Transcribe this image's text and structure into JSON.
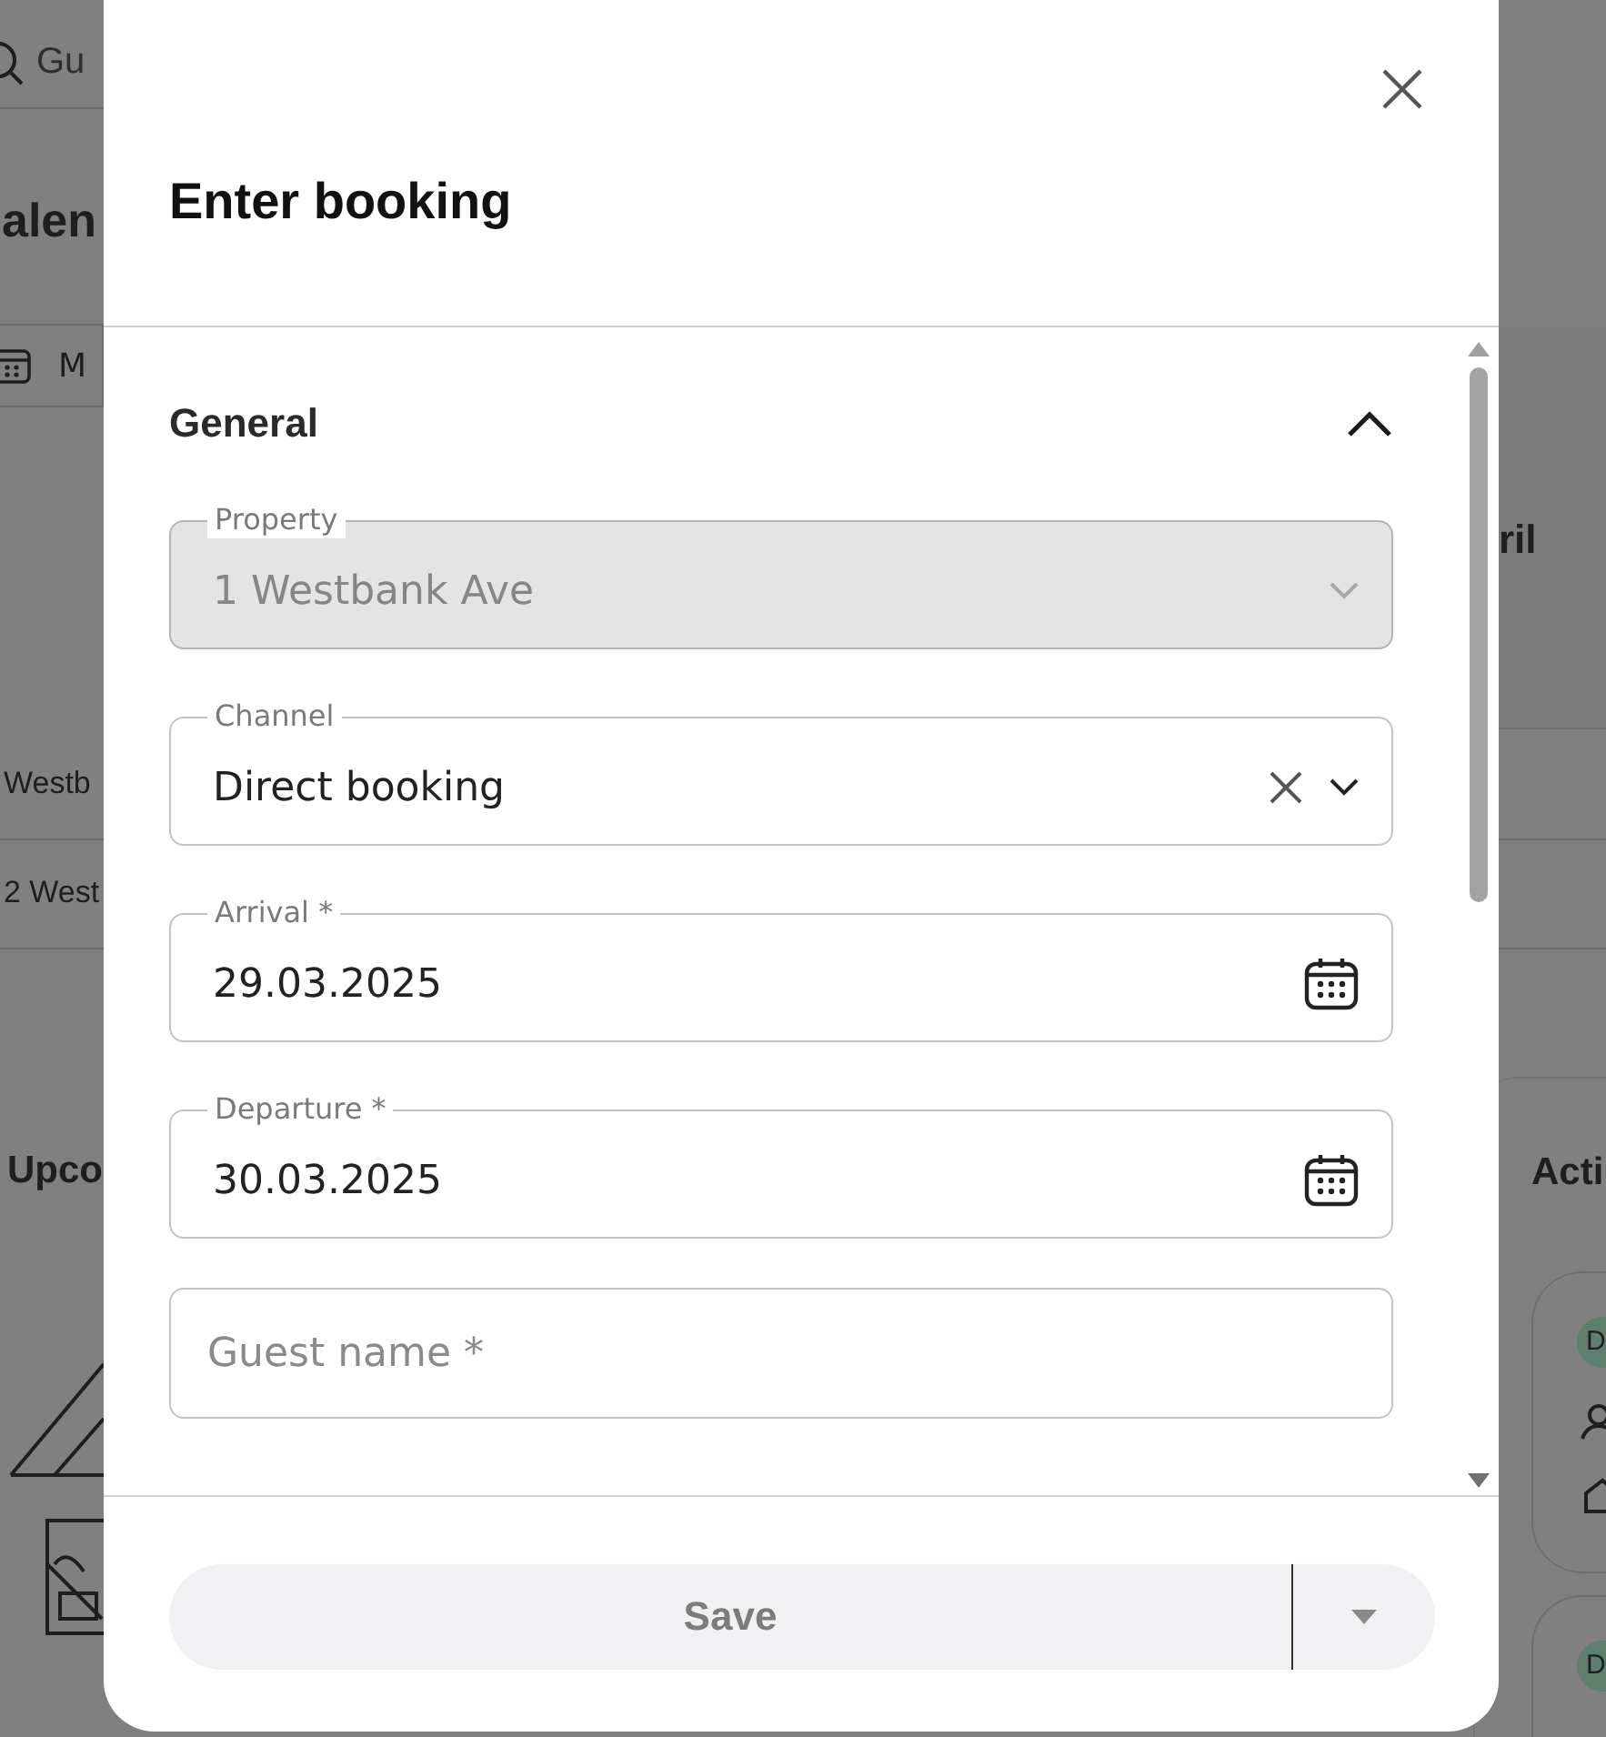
{
  "background": {
    "search_placeholder": "Gu",
    "heading": "alen",
    "view_button": "M",
    "month": "ril",
    "rows": [
      "Westb",
      "2 West"
    ],
    "upcoming": "Upco",
    "activity": "Acti",
    "badges": [
      "D",
      "D"
    ]
  },
  "dialog": {
    "title": "Enter booking",
    "section": {
      "title": "General",
      "expanded": true
    },
    "fields": [
      {
        "kind": "select",
        "label": "Property",
        "value": "1 Westbank Ave",
        "disabled": true,
        "clearable": false
      },
      {
        "kind": "select",
        "label": "Channel",
        "value": "Direct booking",
        "disabled": false,
        "clearable": true
      },
      {
        "kind": "date",
        "label": "Arrival *",
        "value": "29.03.2025"
      },
      {
        "kind": "date",
        "label": "Departure *",
        "value": "30.03.2025"
      },
      {
        "kind": "text",
        "placeholder": "Guest name *"
      }
    ],
    "save_button": {
      "label": "Save",
      "disabled": true
    }
  }
}
